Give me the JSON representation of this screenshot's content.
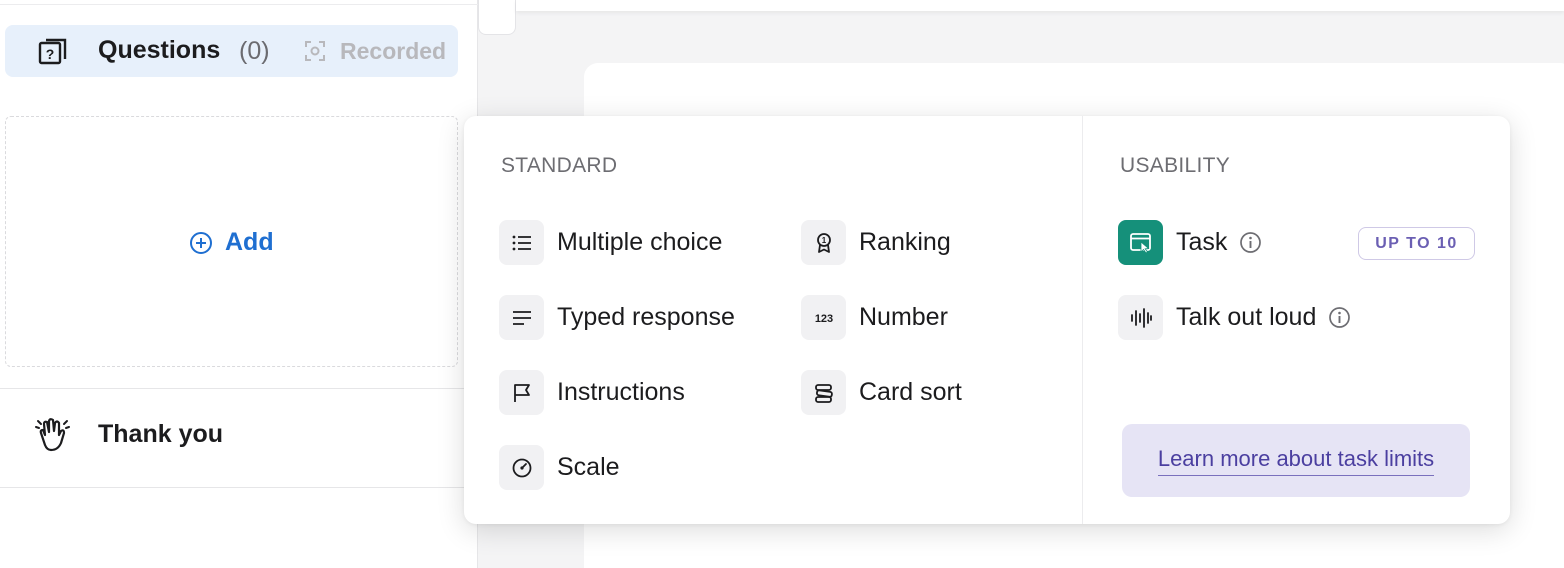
{
  "sidebar": {
    "questions": {
      "title": "Questions",
      "count": "(0)",
      "recorded_label": "Recorded"
    },
    "add_label": "Add",
    "thank_you": "Thank you"
  },
  "popover": {
    "standard": {
      "heading": "STANDARD",
      "items": [
        {
          "label": "Multiple choice",
          "icon": "list-icon"
        },
        {
          "label": "Ranking",
          "icon": "award-icon"
        },
        {
          "label": "Typed response",
          "icon": "text-lines-icon"
        },
        {
          "label": "Number",
          "icon": "123-icon"
        },
        {
          "label": "Instructions",
          "icon": "flag-icon"
        },
        {
          "label": "Card sort",
          "icon": "card-sort-icon"
        },
        {
          "label": "Scale",
          "icon": "gauge-icon"
        }
      ]
    },
    "usability": {
      "heading": "USABILITY",
      "items": [
        {
          "label": "Task",
          "icon": "browser-cursor-icon",
          "badge": "UP TO 10"
        },
        {
          "label": "Talk out loud",
          "icon": "sound-wave-icon"
        }
      ],
      "learn_more": "Learn more about task limits"
    }
  },
  "colors": {
    "accent": "#1f6fd1",
    "task_green": "#15907a",
    "selected_bg": "#e7f0fb",
    "learn_bg": "#e6e4f5",
    "badge_text": "#6b5fb3"
  }
}
